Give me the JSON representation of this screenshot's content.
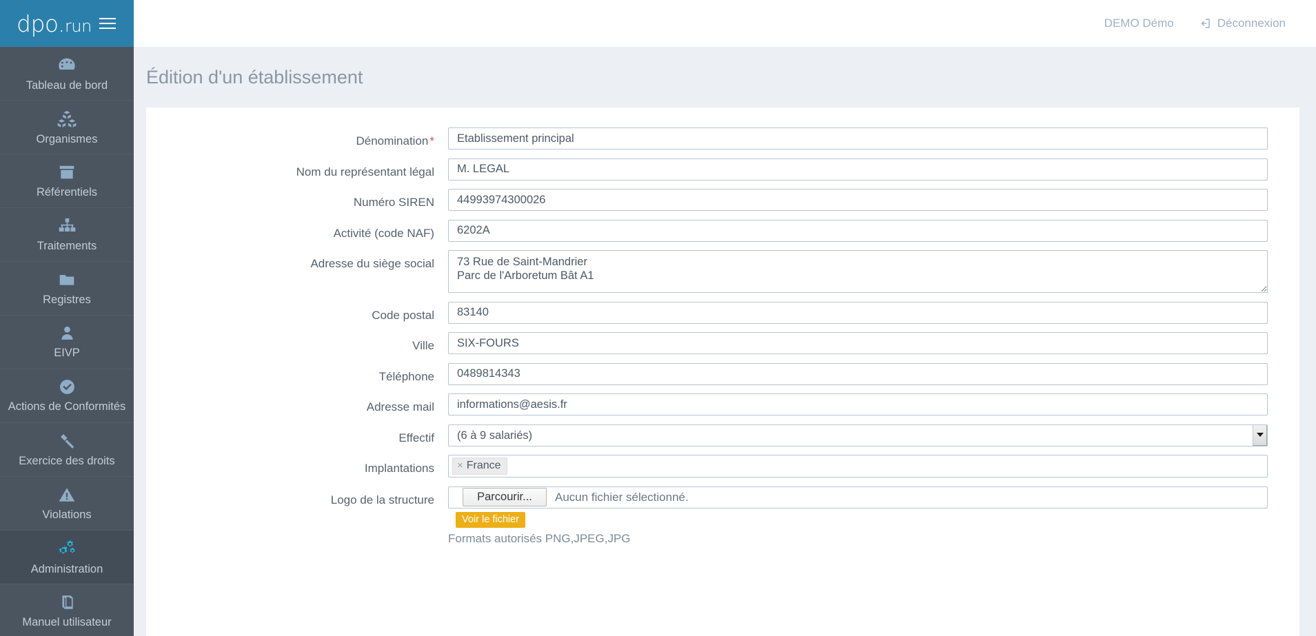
{
  "brand": {
    "name_main": "dpo",
    "name_dot": ".",
    "name_suffix": "run",
    "menu_icon": "hamburger-menu-icon"
  },
  "topbar": {
    "user_label": "DEMO Démo",
    "logout_label": "Déconnexion",
    "logout_icon": "logout-icon"
  },
  "sidebar": {
    "items": [
      {
        "label": "Tableau de bord",
        "icon": "dashboard-gauge-icon",
        "active": false
      },
      {
        "label": "Organismes",
        "icon": "cubes-icon",
        "active": false
      },
      {
        "label": "Référentiels",
        "icon": "archive-box-icon",
        "active": false
      },
      {
        "label": "Traitements",
        "icon": "sitemap-icon",
        "active": false
      },
      {
        "label": "Registres",
        "icon": "folder-icon",
        "active": false
      },
      {
        "label": "EIVP",
        "icon": "user-icon",
        "active": false
      },
      {
        "label": "Actions de Conformités",
        "icon": "check-circle-icon",
        "active": false
      },
      {
        "label": "Exercice des droits",
        "icon": "gavel-icon",
        "active": false
      },
      {
        "label": "Violations",
        "icon": "warning-triangle-icon",
        "active": false
      },
      {
        "label": "Administration",
        "icon": "cogs-icon",
        "active": true
      },
      {
        "label": "Manuel utilisateur",
        "icon": "book-icon",
        "active": false
      }
    ]
  },
  "page": {
    "title": "Édition d'un établissement"
  },
  "form": {
    "fields": {
      "denomination": {
        "label": "Dénomination",
        "required_marker": "*",
        "value": "Etablissement principal"
      },
      "representant": {
        "label": "Nom du représentant légal",
        "value": "M. LEGAL"
      },
      "siren": {
        "label": "Numéro SIREN",
        "value": "44993974300026"
      },
      "naf": {
        "label": "Activité (code NAF)",
        "value": "6202A"
      },
      "adresse": {
        "label": "Adresse du siège social",
        "value": "73 Rue de Saint-Mandrier\nParc de l'Arboretum Bât A1"
      },
      "code_postal": {
        "label": "Code postal",
        "value": "83140"
      },
      "ville": {
        "label": "Ville",
        "value": "SIX-FOURS"
      },
      "telephone": {
        "label": "Téléphone",
        "value": "0489814343"
      },
      "email": {
        "label": "Adresse mail",
        "value": "informations@aesis.fr"
      },
      "effectif": {
        "label": "Effectif",
        "value": "(6 à 9 salariés)"
      },
      "implantations": {
        "label": "Implantations",
        "tokens": [
          {
            "label": "France",
            "remove": "×"
          }
        ]
      },
      "logo": {
        "label": "Logo de la structure",
        "browse_label": "Parcourir...",
        "file_status": "Aucun fichier sélectionné.",
        "view_file_label": "Voir le fichier",
        "hint": "Formats autorisés PNG,JPEG,JPG"
      }
    }
  },
  "colors": {
    "brand_blue": "#2b7fab",
    "sidebar": "#4b5560",
    "sidebar_active": "#434d58",
    "accent_cyan": "#1fb6e0",
    "warning_yellow": "#ecaf16",
    "required_red": "#e74c3c"
  }
}
